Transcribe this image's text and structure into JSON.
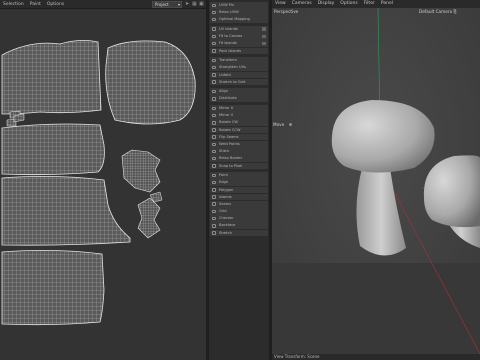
{
  "uv_editor": {
    "menu": [
      "Selection",
      "Paint",
      "Options"
    ],
    "display_mode": "Project",
    "icons": [
      "arrow-icon",
      "grid-icon",
      "lock-icon"
    ]
  },
  "tool_panel": {
    "groups": [
      {
        "items": [
          "UVW Pin",
          "Relax UVW",
          "Optimal Mapping"
        ],
        "icons": [
          "pin-icon",
          "relax-icon",
          "mapping-icon"
        ]
      },
      {
        "items": [
          "UV Islands",
          "Fit to Canvas",
          "Fit Islands",
          "Pack Islands"
        ],
        "icons": [
          "islands-icon",
          "fit-icon",
          "fit-islands-icon",
          "pack-icon"
        ]
      },
      {
        "items": [
          "Transform",
          "Straighten UVs",
          "Unfold",
          "Stretch to Grid"
        ],
        "icons": [
          "transform-icon",
          "straighten-icon",
          "unfold-icon",
          "stretch-icon"
        ]
      },
      {
        "items": [
          "Align",
          "Distribute"
        ],
        "icons": [
          "align-icon",
          "distribute-icon"
        ]
      },
      {
        "items": [
          "Mirror U",
          "Mirror V",
          "Rotate CW",
          "Rotate CCW",
          "Flip Seams",
          "Weld Points",
          "Stitch",
          "Relax Border",
          "Snap to Pixel"
        ],
        "icons": [
          "mirror-u-icon",
          "mirror-v-icon",
          "rotate-cw-icon",
          "rotate-ccw-icon",
          "flip-icon",
          "weld-icon",
          "stitch-icon",
          "border-icon",
          "snap-icon"
        ]
      },
      {
        "items": [
          "Point",
          "Edge",
          "Polygon",
          "Islands",
          "Seams",
          "Grid",
          "Checker",
          "Backface",
          "Stretch"
        ],
        "icons": [
          "point-icon",
          "edge-icon",
          "polygon-icon",
          "islands-mode-icon",
          "seams-icon",
          "grid-mode-icon",
          "checker-icon",
          "backface-icon",
          "stretch-display-icon"
        ]
      }
    ]
  },
  "viewport": {
    "menu": [
      "View",
      "Cameras",
      "Display",
      "Options",
      "Filter",
      "Panel"
    ],
    "perspective_label": "Perspective",
    "camera_label": "Default Camera",
    "camera_icon": "camera-icon",
    "move_label": "Move",
    "bottom_label": "View Transform: Scene"
  }
}
